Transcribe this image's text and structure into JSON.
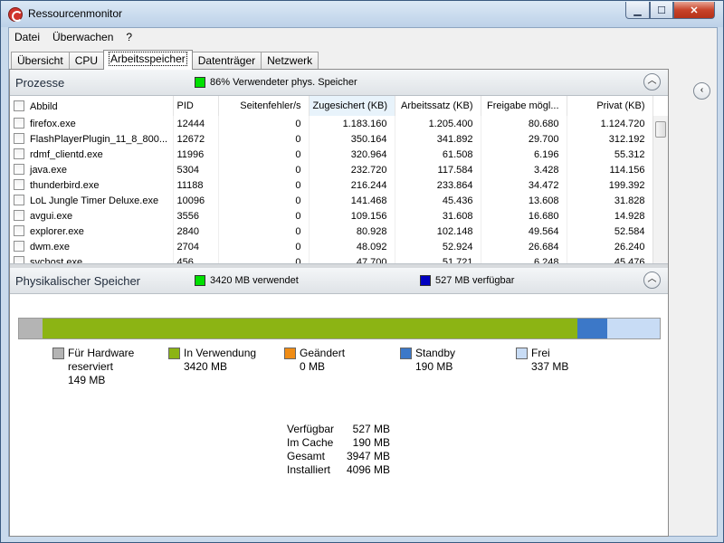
{
  "window": {
    "title": "Ressourcenmonitor"
  },
  "menu": [
    "Datei",
    "Überwachen",
    "?"
  ],
  "tabs": [
    {
      "label": "Übersicht",
      "active": false
    },
    {
      "label": "CPU",
      "active": false
    },
    {
      "label": "Arbeitsspeicher",
      "active": true
    },
    {
      "label": "Datenträger",
      "active": false
    },
    {
      "label": "Netzwerk",
      "active": false
    }
  ],
  "processes": {
    "title": "Prozesse",
    "indicator_color": "#00e000",
    "indicator_text": "86% Verwendeter phys. Speicher",
    "columns": [
      "Abbild",
      "PID",
      "Seitenfehler/s",
      "Zugesichert (KB)",
      "Arbeitssatz (KB)",
      "Freigabe mögl...",
      "Privat (KB)"
    ],
    "rows": [
      [
        "firefox.exe",
        "12444",
        "0",
        "1.183.160",
        "1.205.400",
        "80.680",
        "1.124.720"
      ],
      [
        "FlashPlayerPlugin_11_8_800...",
        "12672",
        "0",
        "350.164",
        "341.892",
        "29.700",
        "312.192"
      ],
      [
        "rdmf_clientd.exe",
        "11996",
        "0",
        "320.964",
        "61.508",
        "6.196",
        "55.312"
      ],
      [
        "java.exe",
        "5304",
        "0",
        "232.720",
        "117.584",
        "3.428",
        "114.156"
      ],
      [
        "thunderbird.exe",
        "11188",
        "0",
        "216.244",
        "233.864",
        "34.472",
        "199.392"
      ],
      [
        "LoL Jungle Timer Deluxe.exe",
        "10096",
        "0",
        "141.468",
        "45.436",
        "13.608",
        "31.828"
      ],
      [
        "avgui.exe",
        "3556",
        "0",
        "109.156",
        "31.608",
        "16.680",
        "14.928"
      ],
      [
        "explorer.exe",
        "2840",
        "0",
        "80.928",
        "102.148",
        "49.564",
        "52.584"
      ],
      [
        "dwm.exe",
        "2704",
        "0",
        "48.092",
        "52.924",
        "26.684",
        "26.240"
      ],
      [
        "svchost.exe",
        "456",
        "0",
        "47.700",
        "51.721",
        "6.248",
        "45.476"
      ]
    ]
  },
  "physical": {
    "title": "Physikalischer Speicher",
    "used_color": "#00e000",
    "used_text": "3420 MB verwendet",
    "avail_color": "#0000c0",
    "avail_text": "527 MB verfügbar",
    "bar_mb": {
      "hardware": 149,
      "in_use": 3420,
      "modified": 0,
      "standby": 190,
      "free": 337
    },
    "legend": [
      {
        "label": "Für Hardware reserviert",
        "line1": "Für Hardware",
        "line2": "reserviert",
        "value": "149 MB",
        "color": "#b4b4b4"
      },
      {
        "label": "In Verwendung",
        "value": "3420 MB",
        "color": "#8cb414"
      },
      {
        "label": "Geändert",
        "value": "0 MB",
        "color": "#f08c14"
      },
      {
        "label": "Standby",
        "value": "190 MB",
        "color": "#3c78c8"
      },
      {
        "label": "Frei",
        "value": "337 MB",
        "color": "#c8dcf5"
      }
    ],
    "summary": [
      {
        "label": "Verfügbar",
        "value": "527 MB"
      },
      {
        "label": "Im Cache",
        "value": "190 MB"
      },
      {
        "label": "Gesamt",
        "value": "3947 MB"
      },
      {
        "label": "Installiert",
        "value": "4096 MB"
      }
    ]
  }
}
